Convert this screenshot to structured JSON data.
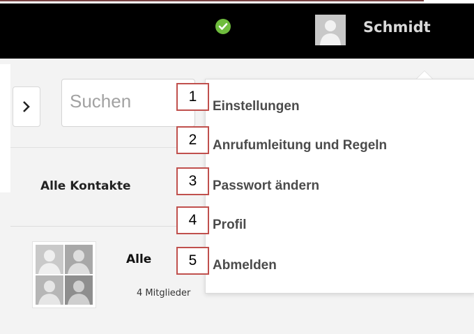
{
  "header": {
    "status_icon": "check-circle-icon",
    "status_color": "#6ebc3d",
    "user_name": "Schmidt"
  },
  "sidebar": {
    "toggle_icon": "chevron-right-icon",
    "search_placeholder": "Suchen",
    "tab_all_contacts": "Alle Kontakte"
  },
  "group": {
    "title": "Alle",
    "members": "4 Mitglieder"
  },
  "menu": {
    "items": [
      {
        "number": "1",
        "label": "Einstellungen"
      },
      {
        "number": "2",
        "label": "Anrufumleitung und Regeln"
      },
      {
        "number": "3",
        "label": "Passwort ändern"
      },
      {
        "number": "4",
        "label": "Profil"
      },
      {
        "number": "5",
        "label": "Abmelden"
      }
    ]
  },
  "colors": {
    "accent_box_border": "#c0504d",
    "topbar": "#000000"
  }
}
